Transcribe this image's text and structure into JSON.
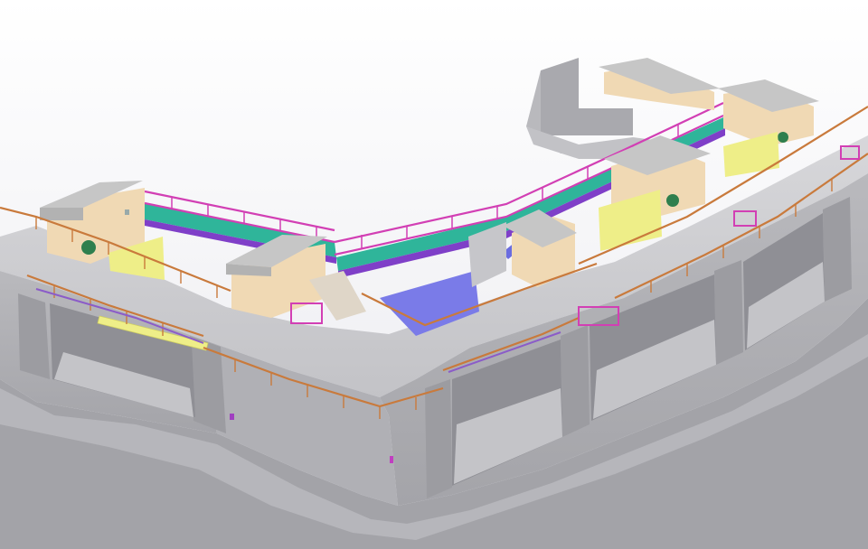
{
  "scene": {
    "subject": "",
    "colors": {
      "background": "#f3f3f6",
      "concrete_top": "#cfcfd2",
      "concrete_side": "#b4b4b8",
      "concrete_dark": "#9d9da2",
      "opening": "#a8a8ad",
      "gatehouse_wall": "#f0d9b4",
      "gatehouse_roof": "#c8c8c8",
      "railing_orange": "#c97a3c",
      "railing_magenta": "#d23fb4",
      "walkway_teal": "#2fb59a",
      "walkway_purple": "#7f3fc8",
      "gate_yellow": "#eeee88",
      "water_blue": "#7a7be8",
      "machinery_green": "#2f7f4e"
    },
    "icons": [
      "gatehouse",
      "railing",
      "sluice-gate",
      "footbridge",
      "hoist"
    ]
  }
}
